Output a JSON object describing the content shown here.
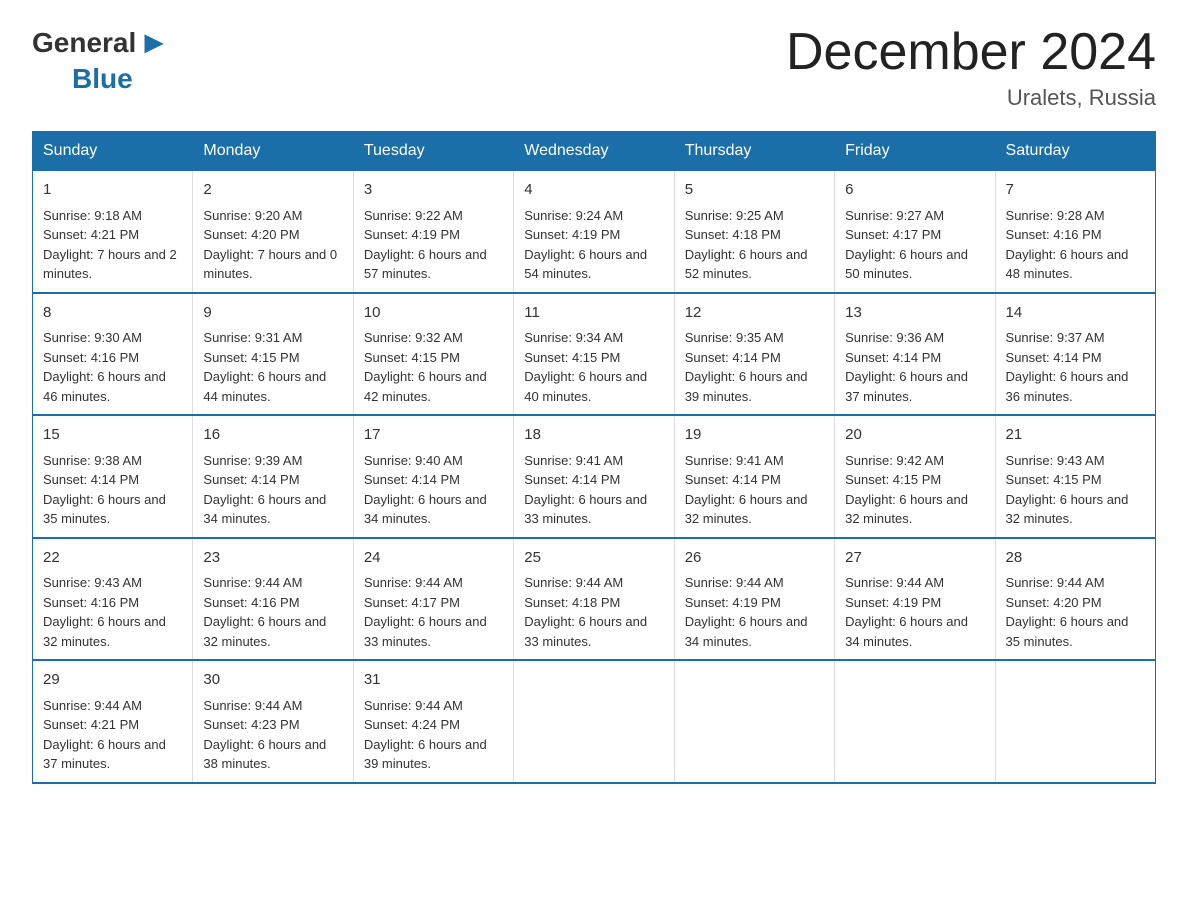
{
  "logo": {
    "general": "General",
    "blue": "Blue"
  },
  "header": {
    "title": "December 2024",
    "location": "Uralets, Russia"
  },
  "days_of_week": [
    "Sunday",
    "Monday",
    "Tuesday",
    "Wednesday",
    "Thursday",
    "Friday",
    "Saturday"
  ],
  "weeks": [
    [
      {
        "day": "1",
        "sunrise": "9:18 AM",
        "sunset": "4:21 PM",
        "daylight": "7 hours and 2 minutes."
      },
      {
        "day": "2",
        "sunrise": "9:20 AM",
        "sunset": "4:20 PM",
        "daylight": "7 hours and 0 minutes."
      },
      {
        "day": "3",
        "sunrise": "9:22 AM",
        "sunset": "4:19 PM",
        "daylight": "6 hours and 57 minutes."
      },
      {
        "day": "4",
        "sunrise": "9:24 AM",
        "sunset": "4:19 PM",
        "daylight": "6 hours and 54 minutes."
      },
      {
        "day": "5",
        "sunrise": "9:25 AM",
        "sunset": "4:18 PM",
        "daylight": "6 hours and 52 minutes."
      },
      {
        "day": "6",
        "sunrise": "9:27 AM",
        "sunset": "4:17 PM",
        "daylight": "6 hours and 50 minutes."
      },
      {
        "day": "7",
        "sunrise": "9:28 AM",
        "sunset": "4:16 PM",
        "daylight": "6 hours and 48 minutes."
      }
    ],
    [
      {
        "day": "8",
        "sunrise": "9:30 AM",
        "sunset": "4:16 PM",
        "daylight": "6 hours and 46 minutes."
      },
      {
        "day": "9",
        "sunrise": "9:31 AM",
        "sunset": "4:15 PM",
        "daylight": "6 hours and 44 minutes."
      },
      {
        "day": "10",
        "sunrise": "9:32 AM",
        "sunset": "4:15 PM",
        "daylight": "6 hours and 42 minutes."
      },
      {
        "day": "11",
        "sunrise": "9:34 AM",
        "sunset": "4:15 PM",
        "daylight": "6 hours and 40 minutes."
      },
      {
        "day": "12",
        "sunrise": "9:35 AM",
        "sunset": "4:14 PM",
        "daylight": "6 hours and 39 minutes."
      },
      {
        "day": "13",
        "sunrise": "9:36 AM",
        "sunset": "4:14 PM",
        "daylight": "6 hours and 37 minutes."
      },
      {
        "day": "14",
        "sunrise": "9:37 AM",
        "sunset": "4:14 PM",
        "daylight": "6 hours and 36 minutes."
      }
    ],
    [
      {
        "day": "15",
        "sunrise": "9:38 AM",
        "sunset": "4:14 PM",
        "daylight": "6 hours and 35 minutes."
      },
      {
        "day": "16",
        "sunrise": "9:39 AM",
        "sunset": "4:14 PM",
        "daylight": "6 hours and 34 minutes."
      },
      {
        "day": "17",
        "sunrise": "9:40 AM",
        "sunset": "4:14 PM",
        "daylight": "6 hours and 34 minutes."
      },
      {
        "day": "18",
        "sunrise": "9:41 AM",
        "sunset": "4:14 PM",
        "daylight": "6 hours and 33 minutes."
      },
      {
        "day": "19",
        "sunrise": "9:41 AM",
        "sunset": "4:14 PM",
        "daylight": "6 hours and 32 minutes."
      },
      {
        "day": "20",
        "sunrise": "9:42 AM",
        "sunset": "4:15 PM",
        "daylight": "6 hours and 32 minutes."
      },
      {
        "day": "21",
        "sunrise": "9:43 AM",
        "sunset": "4:15 PM",
        "daylight": "6 hours and 32 minutes."
      }
    ],
    [
      {
        "day": "22",
        "sunrise": "9:43 AM",
        "sunset": "4:16 PM",
        "daylight": "6 hours and 32 minutes."
      },
      {
        "day": "23",
        "sunrise": "9:44 AM",
        "sunset": "4:16 PM",
        "daylight": "6 hours and 32 minutes."
      },
      {
        "day": "24",
        "sunrise": "9:44 AM",
        "sunset": "4:17 PM",
        "daylight": "6 hours and 33 minutes."
      },
      {
        "day": "25",
        "sunrise": "9:44 AM",
        "sunset": "4:18 PM",
        "daylight": "6 hours and 33 minutes."
      },
      {
        "day": "26",
        "sunrise": "9:44 AM",
        "sunset": "4:19 PM",
        "daylight": "6 hours and 34 minutes."
      },
      {
        "day": "27",
        "sunrise": "9:44 AM",
        "sunset": "4:19 PM",
        "daylight": "6 hours and 34 minutes."
      },
      {
        "day": "28",
        "sunrise": "9:44 AM",
        "sunset": "4:20 PM",
        "daylight": "6 hours and 35 minutes."
      }
    ],
    [
      {
        "day": "29",
        "sunrise": "9:44 AM",
        "sunset": "4:21 PM",
        "daylight": "6 hours and 37 minutes."
      },
      {
        "day": "30",
        "sunrise": "9:44 AM",
        "sunset": "4:23 PM",
        "daylight": "6 hours and 38 minutes."
      },
      {
        "day": "31",
        "sunrise": "9:44 AM",
        "sunset": "4:24 PM",
        "daylight": "6 hours and 39 minutes."
      },
      null,
      null,
      null,
      null
    ]
  ],
  "labels": {
    "sunrise": "Sunrise:",
    "sunset": "Sunset:",
    "daylight": "Daylight:"
  }
}
